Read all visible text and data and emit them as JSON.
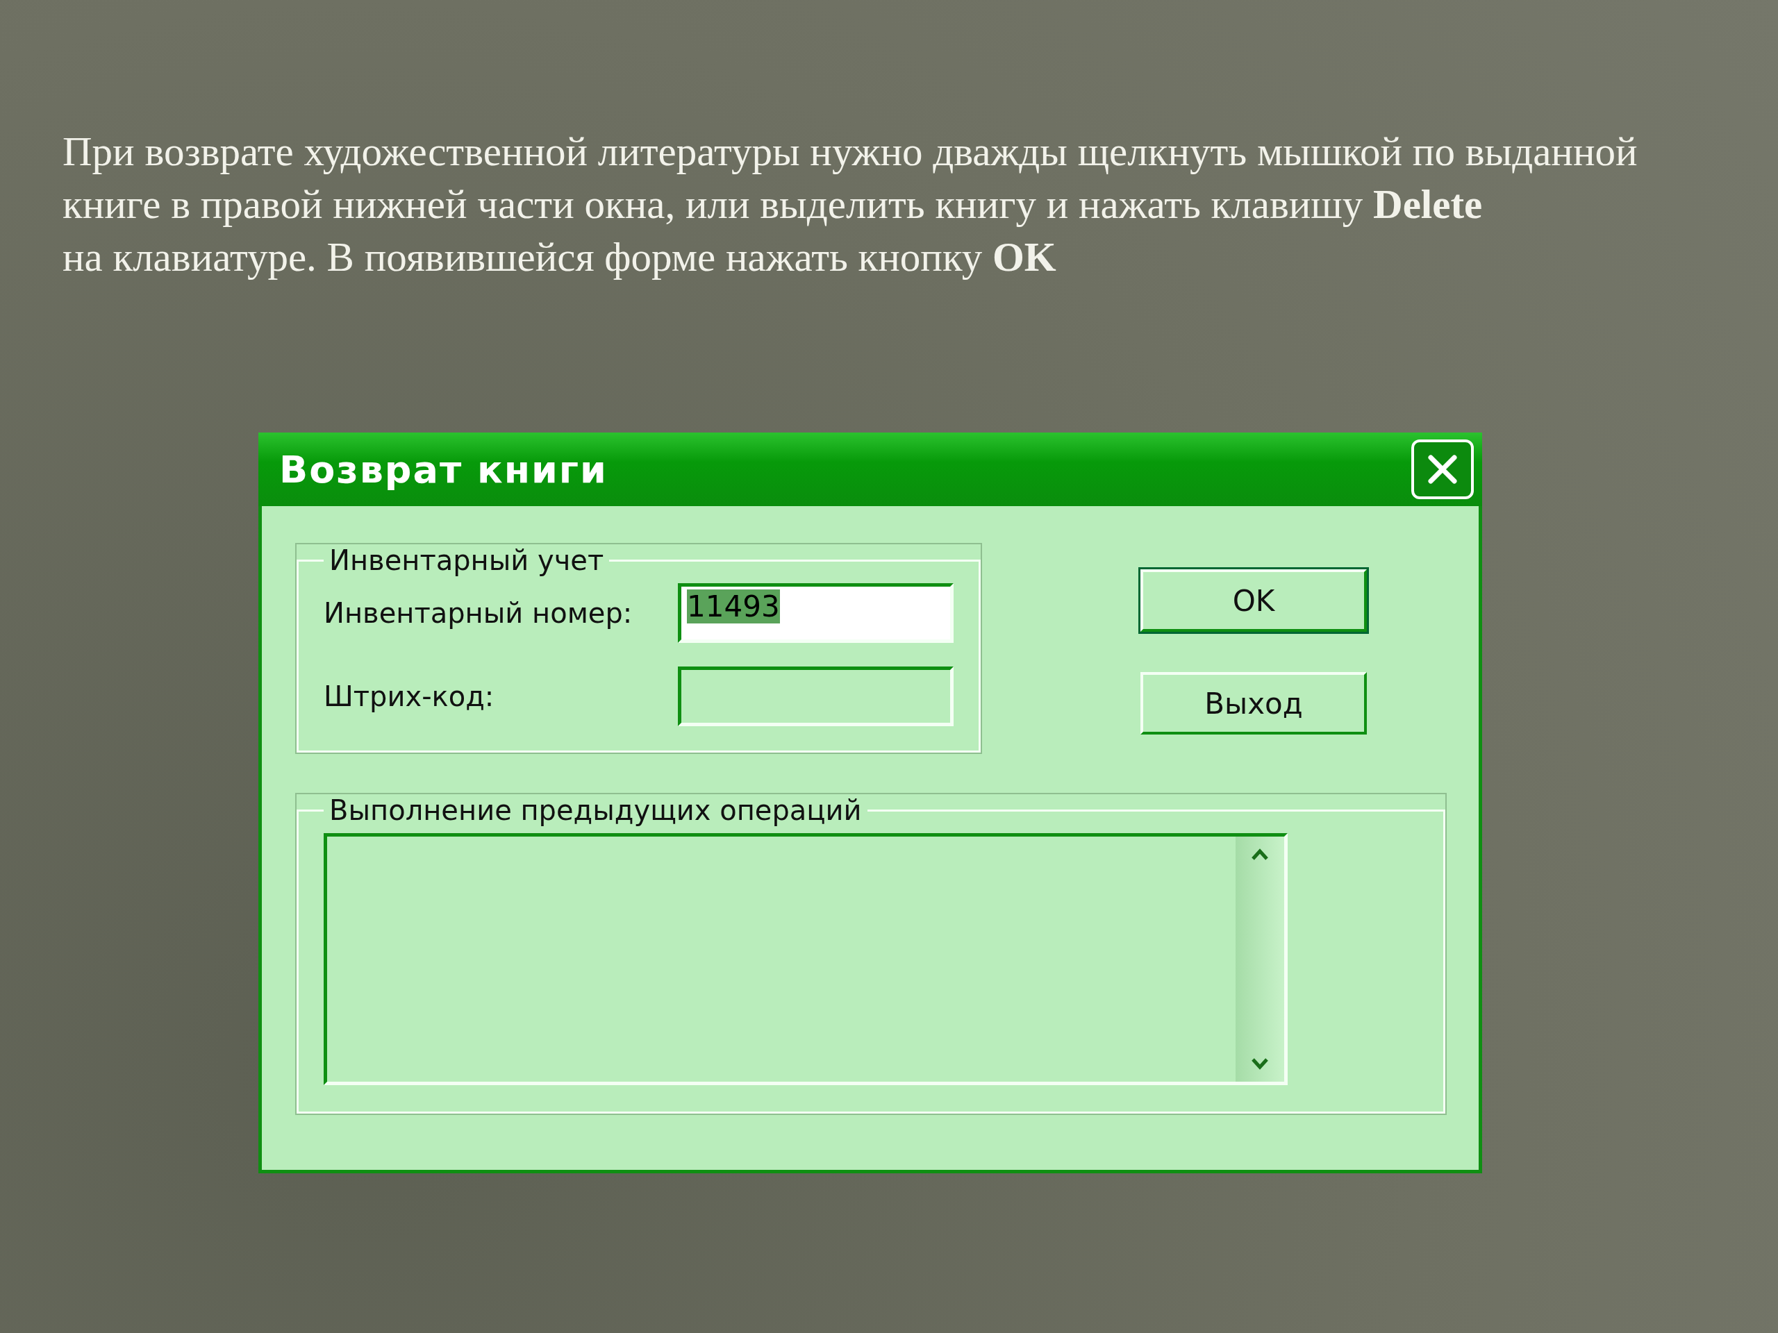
{
  "slide": {
    "text": "При возврате художественной литературы нужно дважды щелкнуть мышкой по выданной\nкниге в правой нижней части окна, или выделить книгу и нажать клавишу **Delete**\n на клавиатуре. В появившейся форме нажать кнопку **OK**"
  },
  "window": {
    "title": "Возврат книги"
  },
  "inventory_group": {
    "title": "Инвентарный учет",
    "fields": [
      {
        "label": "Инвентарный номер:",
        "value": "11493",
        "value_selected": true,
        "focused": true
      },
      {
        "label": "Штрих-код:",
        "focused": false
      }
    ]
  },
  "buttons": [
    {
      "label": "OK",
      "default": true
    },
    {
      "label": "Выход",
      "default": false
    }
  ],
  "history_group": {
    "title": "Выполнение предыдущих операций"
  }
}
